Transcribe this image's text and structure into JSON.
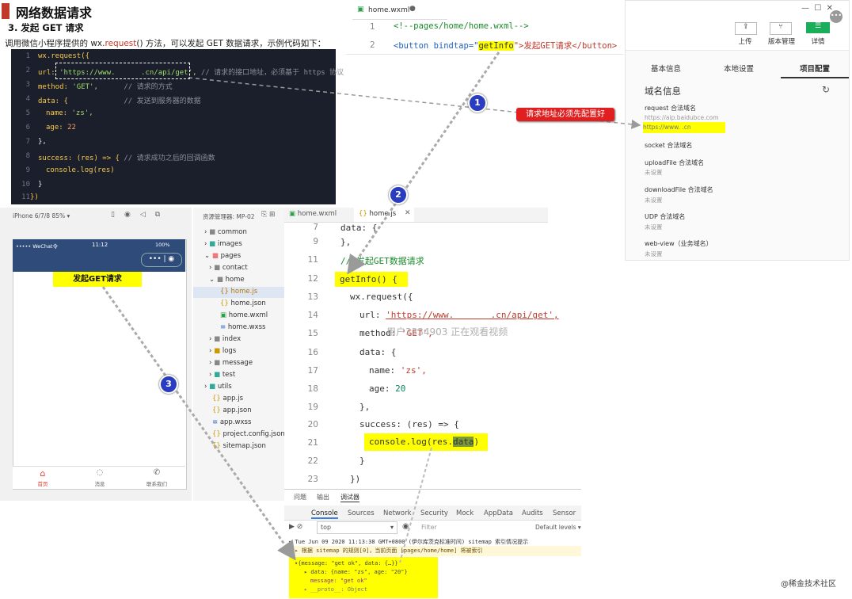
{
  "header": {
    "title": "网络数据请求",
    "subtitle": "3. 发起 GET 请求",
    "desc_prefix": "调用微信小程序提供的 wx.",
    "desc_keyword": "request",
    "desc_suffix": "() 方法，可以发起 GET 数据请求，示例代码如下："
  },
  "code_example": {
    "line_numbers": [
      "1",
      "2",
      "3",
      "4",
      "5",
      "6",
      "7",
      "8",
      "9",
      "10",
      "11"
    ],
    "l1": "wx.request({",
    "l2_key": "url: ",
    "l2_val": "'https://www.      .cn/api/get',",
    "l2_cmt": " // 请求的接口地址，必须基于 https 协议",
    "l3_key": "method: ",
    "l3_val": "'GET',",
    "l3_cmt": "      // 请求的方式",
    "l4_key": "data: {",
    "l4_cmt": "             // 发送到服务器的数据",
    "l5_key": "name: ",
    "l5_val": "'zs',",
    "l6_key": "age: ",
    "l6_val": "22",
    "l7": "},",
    "l8_key": "success: (res) => { ",
    "l8_cmt": "// 请求成功之后的回调函数",
    "l9": "console.log(res)",
    "l10": "}",
    "l11": "})"
  },
  "wxml_editor": {
    "tab": "home.wxml",
    "line1_num": "1",
    "line1": "<!--pages/home/home.wxml-->",
    "line2_num": "2",
    "line2_open": "<button bindtap=\"",
    "line2_hl": "getInfo",
    "line2_close": "\">发起GET请求</button>"
  },
  "right_panel": {
    "upload": "上传",
    "version": "版本管理",
    "details": "详情",
    "tabs": [
      "基本信息",
      "本地设置",
      "项目配置"
    ],
    "domain_title": "域名信息",
    "request_label": "request 合法域名",
    "request_val1": "https://aip.baidubce.com",
    "request_val2": "https://www.        .cn",
    "socket_label": "socket 合法域名",
    "upload_label": "uploadFile 合法域名",
    "upload_val": "未设置",
    "download_label": "downloadFile 合法域名",
    "download_val": "未设置",
    "udp_label": "UDP 合法域名",
    "udp_val": "未设置",
    "webview_label": "web-view（业务域名）",
    "webview_val": "未设置"
  },
  "callout": {
    "text": "请求地址必须先配置好"
  },
  "badges": [
    "1",
    "2",
    "3"
  ],
  "simulator": {
    "device": "iPhone 6/7/8 85% ▾",
    "status_left": "••••• WeChat令",
    "status_time": "11:12",
    "status_right": "100%",
    "button_label": "发起GET请求",
    "tabbar": [
      "首页",
      "消息",
      "联系我们"
    ]
  },
  "explorer": {
    "header": "资源管理器: MP-02",
    "items": [
      "common",
      "images",
      "pages",
      "contact",
      "home",
      "home.js",
      "home.json",
      "home.wxml",
      "home.wxss",
      "index",
      "logs",
      "message",
      "test",
      "utils",
      "app.js",
      "app.json",
      "app.wxss",
      "project.config.json",
      "sitemap.json"
    ]
  },
  "js_editor": {
    "tabs": [
      "home.wxml",
      "home.js"
    ],
    "line_numbers": [
      "7",
      "9",
      "11",
      "12",
      "13",
      "14",
      "15",
      "16",
      "17",
      "18",
      "19",
      "20",
      "21",
      "22",
      "23"
    ],
    "l7": "data: {",
    "l9": "},",
    "l11": "// 发起GET数据请求",
    "l12": "getInfo() {",
    "l13": "wx.request({",
    "l14_key": "url: ",
    "l14_val": "'https://www.       .cn/api/get',",
    "l15_key": "method: ",
    "l15_val": "'GET',",
    "l16": "data: {",
    "l17_key": "name: ",
    "l17_val": "'zs',",
    "l18_key": "age: ",
    "l18_val": "20",
    "l19": "},",
    "l20": "success: (res) => {",
    "l21_a": "console.log(res.",
    "l21_b": "data",
    "l21_c": ")",
    "l22": "}",
    "l23": "})",
    "watermark": "用户3334903 正在观看视频"
  },
  "console_panel": {
    "top_tabs": [
      "问题",
      "输出",
      "调试器"
    ],
    "tabs": [
      "Console",
      "Sources",
      "Network",
      "Security",
      "Mock",
      "AppData",
      "Audits",
      "Sensor"
    ],
    "context": "top",
    "filter_placeholder": "Filter",
    "levels": "Default levels ▾",
    "log1": "▾ Tue Jun 09 2020 11:13:38 GMT+0800 (伊尔库茨克标准时间) sitemap 索引情况提示",
    "log2": "▲ ▸ 根据 sitemap 的规则[0]，当前页面 [pages/home/home] 将被索引",
    "obj1": "▾{message: \"get ok\", data: {…}} ",
    "obj2": "▸ data: {name: \"zs\", age: \"20\"}",
    "obj3": "message: \"get ok\"",
    "obj4": "▸ __proto__: Object"
  },
  "footer": {
    "brand": "@稀金技术社区"
  },
  "colors": {
    "highlight": "#ffff00",
    "badge": "#2a3cbf",
    "callout_bg": "#e02020",
    "code_bg": "#1b1f2b",
    "nav_bg": "#2e4b7a",
    "tab_active": "#e03c31"
  }
}
